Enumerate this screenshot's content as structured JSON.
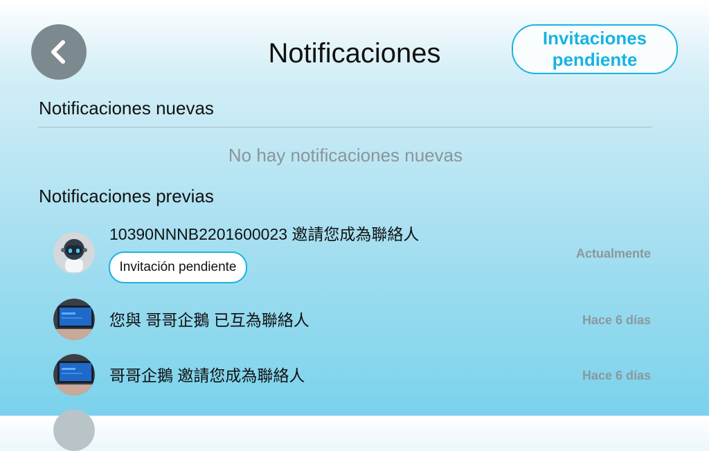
{
  "header": {
    "title": "Notificaciones",
    "pending_button_label": "Invitaciones pendiente"
  },
  "new_section": {
    "title": "Notificaciones nuevas",
    "empty_message": "No hay notificaciones nuevas"
  },
  "previous_section": {
    "title": "Notificaciones previas",
    "items": [
      {
        "message": "10390NNNB2201600023 邀請您成為聯絡人",
        "time": "Actualmente",
        "action_label": "Invitación pendiente",
        "avatar": "robot-avatar"
      },
      {
        "message": "您與 哥哥企鵝 已互為聯絡人",
        "time": "Hace 6 días",
        "avatar": "screen-photo-avatar"
      },
      {
        "message": "哥哥企鵝 邀請您成為聯絡人",
        "time": "Hace 6 días",
        "avatar": "screen-photo-avatar"
      }
    ]
  },
  "colors": {
    "accent": "#18b4de",
    "back_button": "#7c8a8f",
    "muted_text": "#8a9599"
  }
}
